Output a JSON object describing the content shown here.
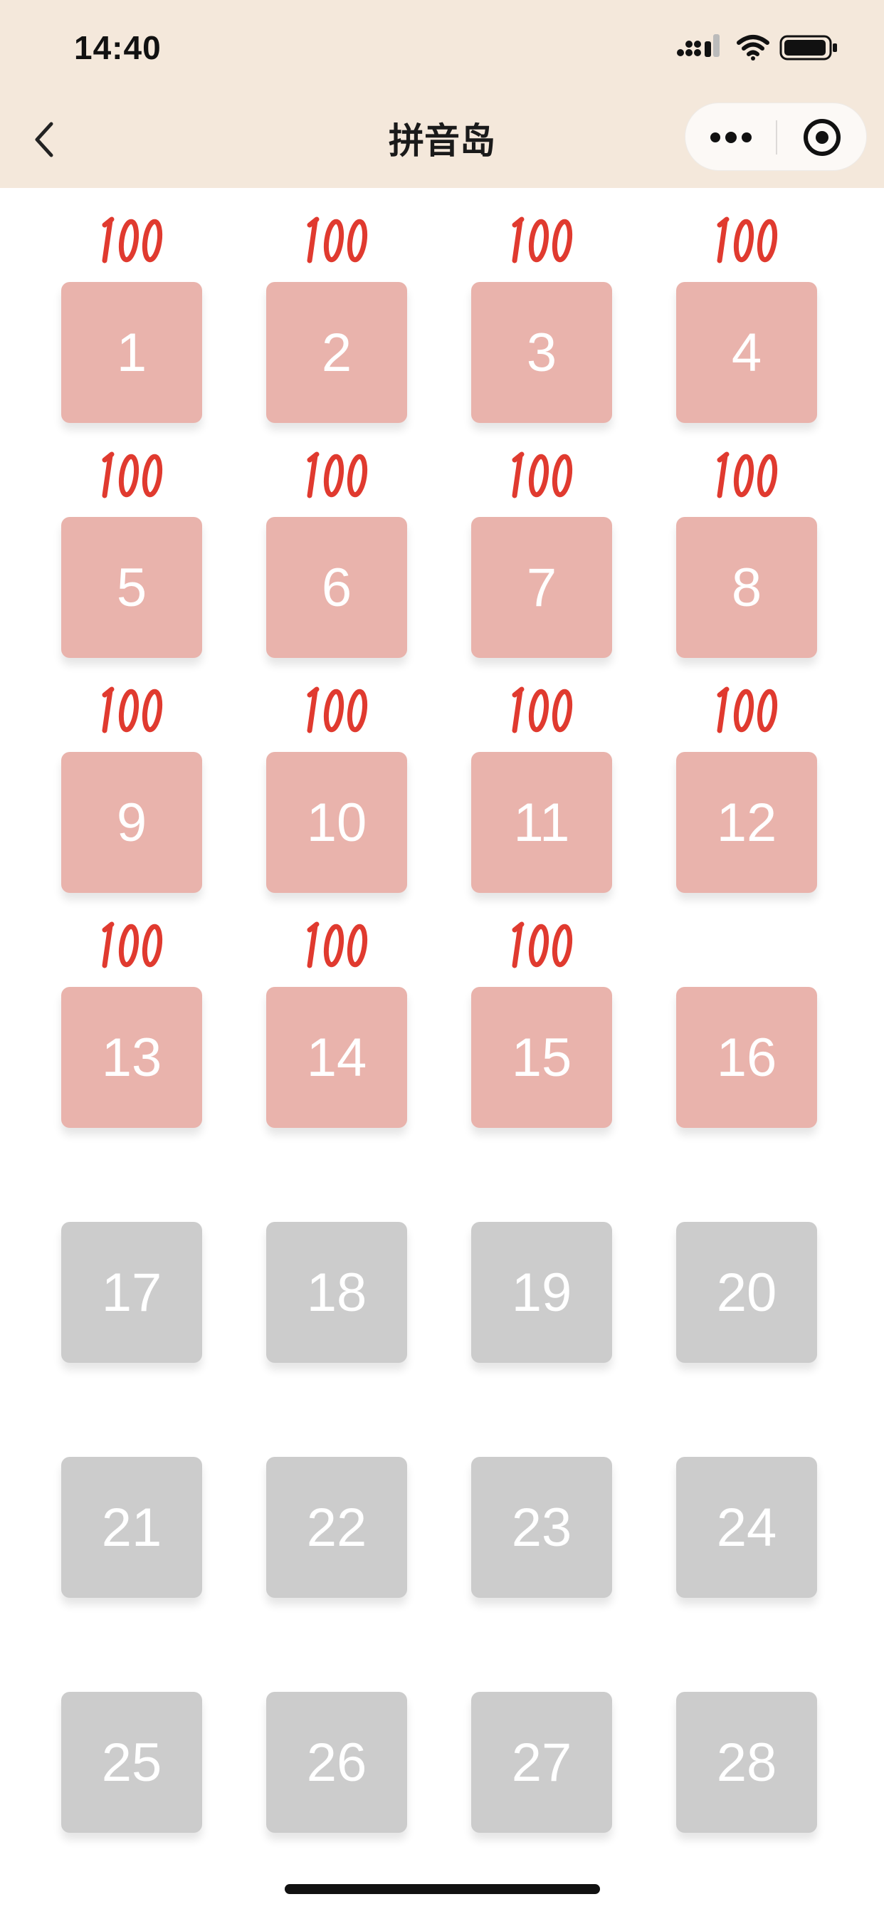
{
  "status_bar": {
    "time": "14:40",
    "icons": [
      "signal-icon",
      "wifi-icon",
      "battery-icon"
    ]
  },
  "nav": {
    "title": "拼音岛",
    "back_icon": "chevron-left-icon",
    "capsule": {
      "more_icon": "more-dots-icon",
      "close_icon": "target-circle-icon"
    }
  },
  "colors": {
    "header_bg": "#f4e8db",
    "unlocked_tile": "#e9b3ac",
    "locked_tile": "#cccccc",
    "score_red": "#e03a2f"
  },
  "levels": [
    {
      "number": "1",
      "unlocked": true,
      "score": "100"
    },
    {
      "number": "2",
      "unlocked": true,
      "score": "100"
    },
    {
      "number": "3",
      "unlocked": true,
      "score": "100"
    },
    {
      "number": "4",
      "unlocked": true,
      "score": "100"
    },
    {
      "number": "5",
      "unlocked": true,
      "score": "100"
    },
    {
      "number": "6",
      "unlocked": true,
      "score": "100"
    },
    {
      "number": "7",
      "unlocked": true,
      "score": "100"
    },
    {
      "number": "8",
      "unlocked": true,
      "score": "100"
    },
    {
      "number": "9",
      "unlocked": true,
      "score": "100"
    },
    {
      "number": "10",
      "unlocked": true,
      "score": "100"
    },
    {
      "number": "11",
      "unlocked": true,
      "score": "100"
    },
    {
      "number": "12",
      "unlocked": true,
      "score": "100"
    },
    {
      "number": "13",
      "unlocked": true,
      "score": "100"
    },
    {
      "number": "14",
      "unlocked": true,
      "score": "100"
    },
    {
      "number": "15",
      "unlocked": true,
      "score": "100"
    },
    {
      "number": "16",
      "unlocked": true,
      "score": null
    },
    {
      "number": "17",
      "unlocked": false,
      "score": null
    },
    {
      "number": "18",
      "unlocked": false,
      "score": null
    },
    {
      "number": "19",
      "unlocked": false,
      "score": null
    },
    {
      "number": "20",
      "unlocked": false,
      "score": null
    },
    {
      "number": "21",
      "unlocked": false,
      "score": null
    },
    {
      "number": "22",
      "unlocked": false,
      "score": null
    },
    {
      "number": "23",
      "unlocked": false,
      "score": null
    },
    {
      "number": "24",
      "unlocked": false,
      "score": null
    },
    {
      "number": "25",
      "unlocked": false,
      "score": null
    },
    {
      "number": "26",
      "unlocked": false,
      "score": null
    },
    {
      "number": "27",
      "unlocked": false,
      "score": null
    },
    {
      "number": "28",
      "unlocked": false,
      "score": null
    }
  ]
}
